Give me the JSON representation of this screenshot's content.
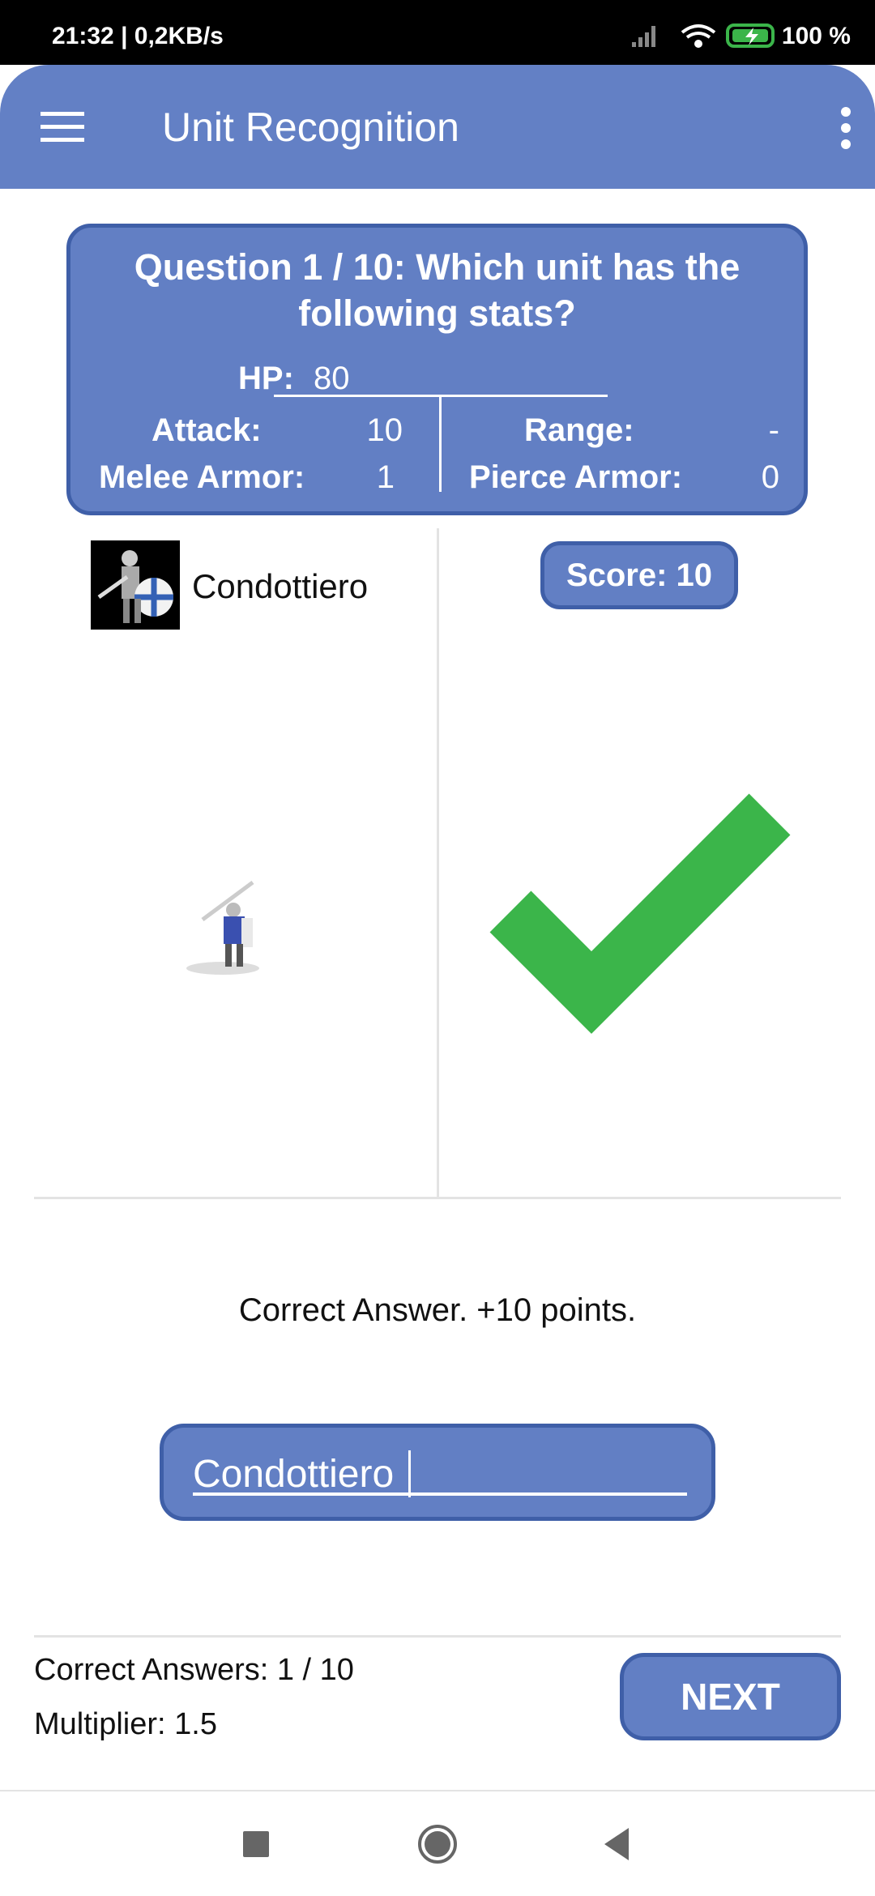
{
  "status_bar": {
    "time_speed": "21:32 | 0,2KB/s",
    "battery": "100 %"
  },
  "app_bar": {
    "title": "Unit Recognition",
    "menu_icon": "hamburger-icon",
    "more_icon": "more-vert-icon"
  },
  "question": {
    "text": "Question 1 / 10: Which unit has the following stats?",
    "hp_label": "HP:",
    "hp_value": "80",
    "attack_label": "Attack:",
    "attack_value": "10",
    "range_label": "Range:",
    "range_value": "-",
    "melee_armor_label": "Melee Armor:",
    "melee_armor_value": "1",
    "pierce_armor_label": "Pierce Armor:",
    "pierce_armor_value": "0"
  },
  "unit": {
    "name": "Condottiero"
  },
  "score": "Score: 10",
  "result_icon": "checkmark-icon",
  "colors": {
    "primary": "#627fc4",
    "border": "#3f5fa8",
    "check": "#3bb54a"
  },
  "feedback": "Correct Answer. +10 points.",
  "answer_input": {
    "value": "Condottiero"
  },
  "footer": {
    "correct_answers": "Correct Answers: 1 / 10",
    "multiplier": "Multiplier: 1.5",
    "next_label": "NEXT"
  }
}
